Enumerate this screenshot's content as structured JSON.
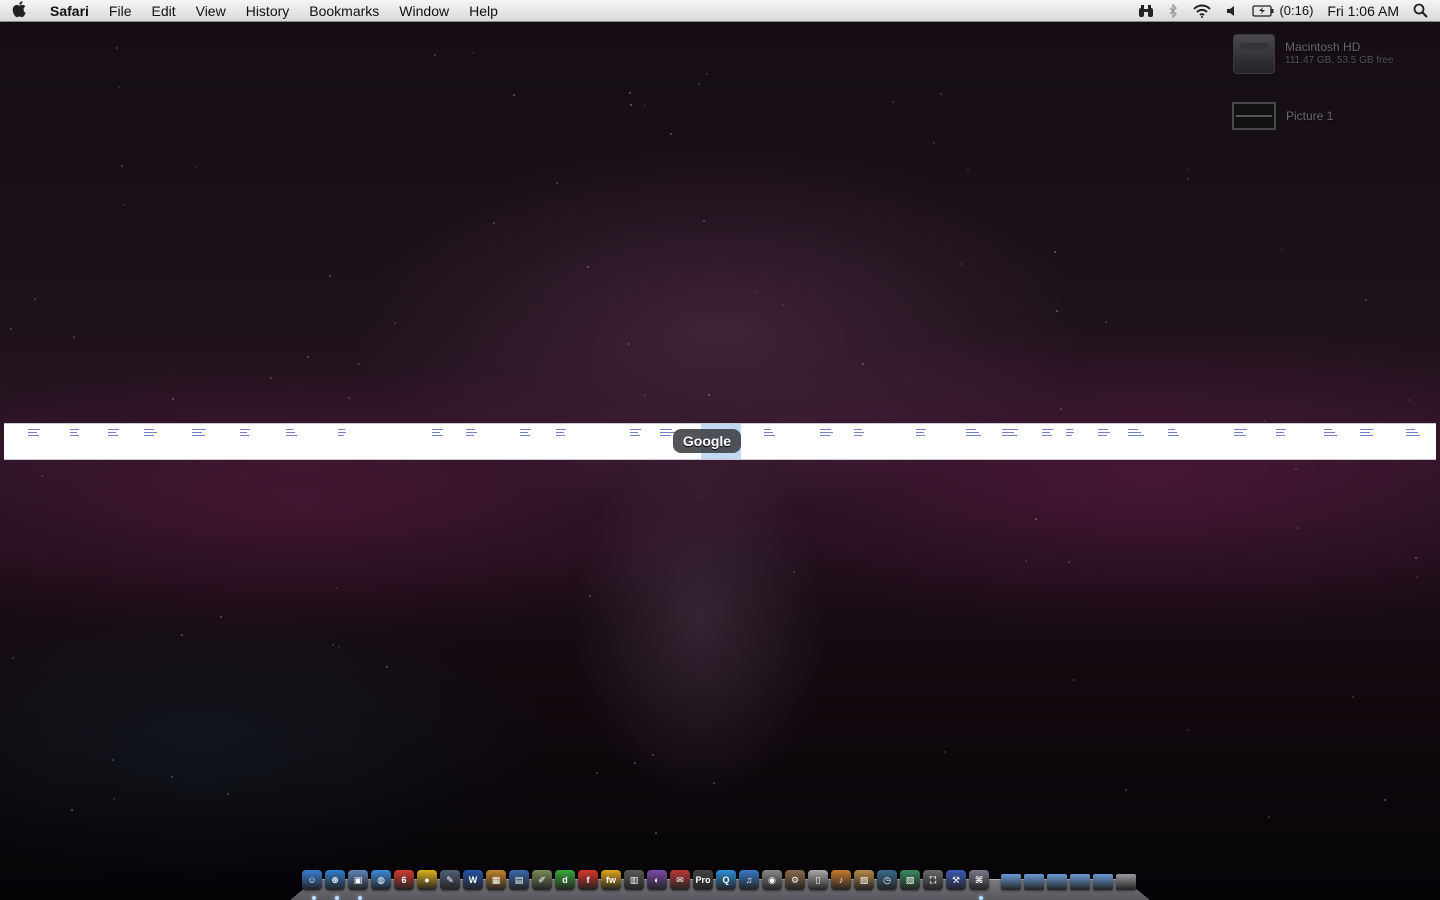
{
  "menubar": {
    "app_name": "Safari",
    "menus": [
      "File",
      "Edit",
      "View",
      "History",
      "Bookmarks",
      "Window",
      "Help"
    ],
    "status": {
      "battery_text": "(0:16)",
      "clock": "Fri 1:06 AM"
    },
    "status_icons": [
      "binoculars-icon",
      "bluetooth-icon",
      "wifi-icon",
      "volume-icon",
      "battery-icon",
      "spotlight-icon"
    ]
  },
  "desktop": {
    "items": [
      {
        "name": "Macintosh HD",
        "detail": "111.47 GB, 53.5 GB free",
        "icon": "hard-drive-icon"
      },
      {
        "name": "Picture 1",
        "icon": "picture-file-icon"
      }
    ]
  },
  "tooltip": {
    "label": "Google"
  },
  "dock": {
    "apps": [
      {
        "icon": "finder-icon",
        "color": "#3b7fd6",
        "glyph": "☺"
      },
      {
        "icon": "safari-icon",
        "color": "#2f7fcf",
        "glyph": "⊕"
      },
      {
        "icon": "preview-icon",
        "color": "#5d84b8",
        "glyph": "▣"
      },
      {
        "icon": "ichat-icon",
        "color": "#3c8ad8",
        "glyph": "◍"
      },
      {
        "icon": "ical-icon",
        "color": "#d23b32",
        "glyph": "6"
      },
      {
        "icon": "adium-icon",
        "color": "#e0b21c",
        "glyph": "●"
      },
      {
        "icon": "quill-icon",
        "color": "#506078",
        "glyph": "✎"
      },
      {
        "icon": "word-icon",
        "color": "#2553a7",
        "glyph": "W"
      },
      {
        "icon": "photo-icon",
        "color": "#c7842c",
        "glyph": "▦"
      },
      {
        "icon": "clapper-icon",
        "color": "#3a66a8",
        "glyph": "▤"
      },
      {
        "icon": "textedit-icon",
        "color": "#7a8a58",
        "glyph": "✐"
      },
      {
        "icon": "dreamweaver-icon",
        "color": "#3aa83a",
        "glyph": "d"
      },
      {
        "icon": "flash-icon",
        "color": "#d8342a",
        "glyph": "f"
      },
      {
        "icon": "fireworks-icon",
        "color": "#e0a418",
        "glyph": "fw"
      },
      {
        "icon": "film-icon",
        "color": "#5a5a5a",
        "glyph": "▥"
      },
      {
        "icon": "colorsync-icon",
        "color": "#7a4aa8",
        "glyph": "◐"
      },
      {
        "icon": "mail-icon",
        "color": "#b83838",
        "glyph": "✉"
      },
      {
        "icon": "pro-icon",
        "color": "#444",
        "glyph": "Pro"
      },
      {
        "icon": "quicktime-icon",
        "color": "#2f8fd8",
        "glyph": "Q"
      },
      {
        "icon": "itunes-icon",
        "color": "#3a78c8",
        "glyph": "♫"
      },
      {
        "icon": "dvd-icon",
        "color": "#888",
        "glyph": "◉"
      },
      {
        "icon": "utility-icon",
        "color": "#8a6a4a",
        "glyph": "⚙"
      },
      {
        "icon": "ipod-icon",
        "color": "#aaa",
        "glyph": "▯"
      },
      {
        "icon": "garageband-icon",
        "color": "#c87a2a",
        "glyph": "♪"
      },
      {
        "icon": "iphoto-icon",
        "color": "#b88a48",
        "glyph": "▨"
      },
      {
        "icon": "timemachine-icon",
        "color": "#3a6a8a",
        "glyph": "◷"
      },
      {
        "icon": "photobooth-icon",
        "color": "#3a8a5a",
        "glyph": "▧"
      },
      {
        "icon": "screen-icon",
        "color": "#6a6a6a",
        "glyph": "⛶"
      },
      {
        "icon": "xcode-icon",
        "color": "#3a5ab8",
        "glyph": "⚒"
      },
      {
        "icon": "mac-icon",
        "color": "#7a7a8a",
        "glyph": "⌘"
      }
    ],
    "folders": [
      {
        "icon": "applications-folder-icon",
        "color": "#6a9ad8"
      },
      {
        "icon": "documents-folder-icon",
        "color": "#6a9ad8"
      },
      {
        "icon": "downloads-folder-icon",
        "color": "#6a9ad8"
      },
      {
        "icon": "home-folder-icon",
        "color": "#6a9ad8"
      },
      {
        "icon": "folder-icon",
        "color": "#6a9ad8"
      },
      {
        "icon": "trash-icon",
        "color": "#9a9aa2"
      }
    ]
  }
}
